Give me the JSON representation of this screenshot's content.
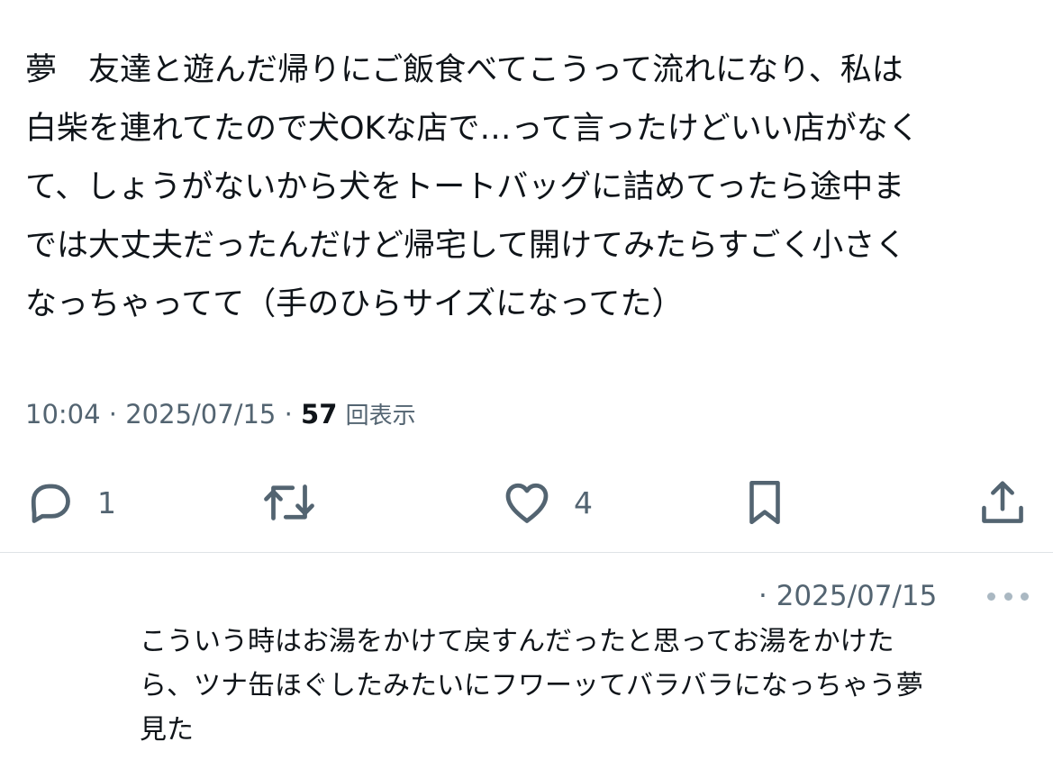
{
  "tweet": {
    "text_lines": [
      "夢　友達と遊んだ帰りにご飯食べてこうって流れになり、私は",
      "白柴を連れてたので犬OKな店で…って言ったけどいい店がなく",
      "て、しょうがないから犬をトートバッグに詰めてったら途中ま",
      "では大丈夫だったんだけど帰宅して開けてみたらすごく小さく",
      "なっちゃってて（手のひらサイズになってた）"
    ],
    "time": "10:04",
    "separator": "·",
    "date": "2025/07/15",
    "views_count": "57",
    "views_label": "回表示"
  },
  "actions": {
    "reply_count": "1",
    "like_count": "4",
    "icons": [
      "reply-icon",
      "retweet-icon",
      "like-icon",
      "bookmark-icon",
      "share-icon"
    ]
  },
  "reply": {
    "meta": "· 2025/07/15",
    "more_icon": "more-icon",
    "text_lines": [
      "こういう時はお湯をかけて戻すんだったと思ってお湯をかけた",
      "ら、ツナ缶ほぐしたみたいにフワーッてバラバラになっちゃう夢",
      "見た"
    ]
  },
  "colors": {
    "text": "#0f1419",
    "secondary": "#536471",
    "divider": "#dfe3e6"
  }
}
